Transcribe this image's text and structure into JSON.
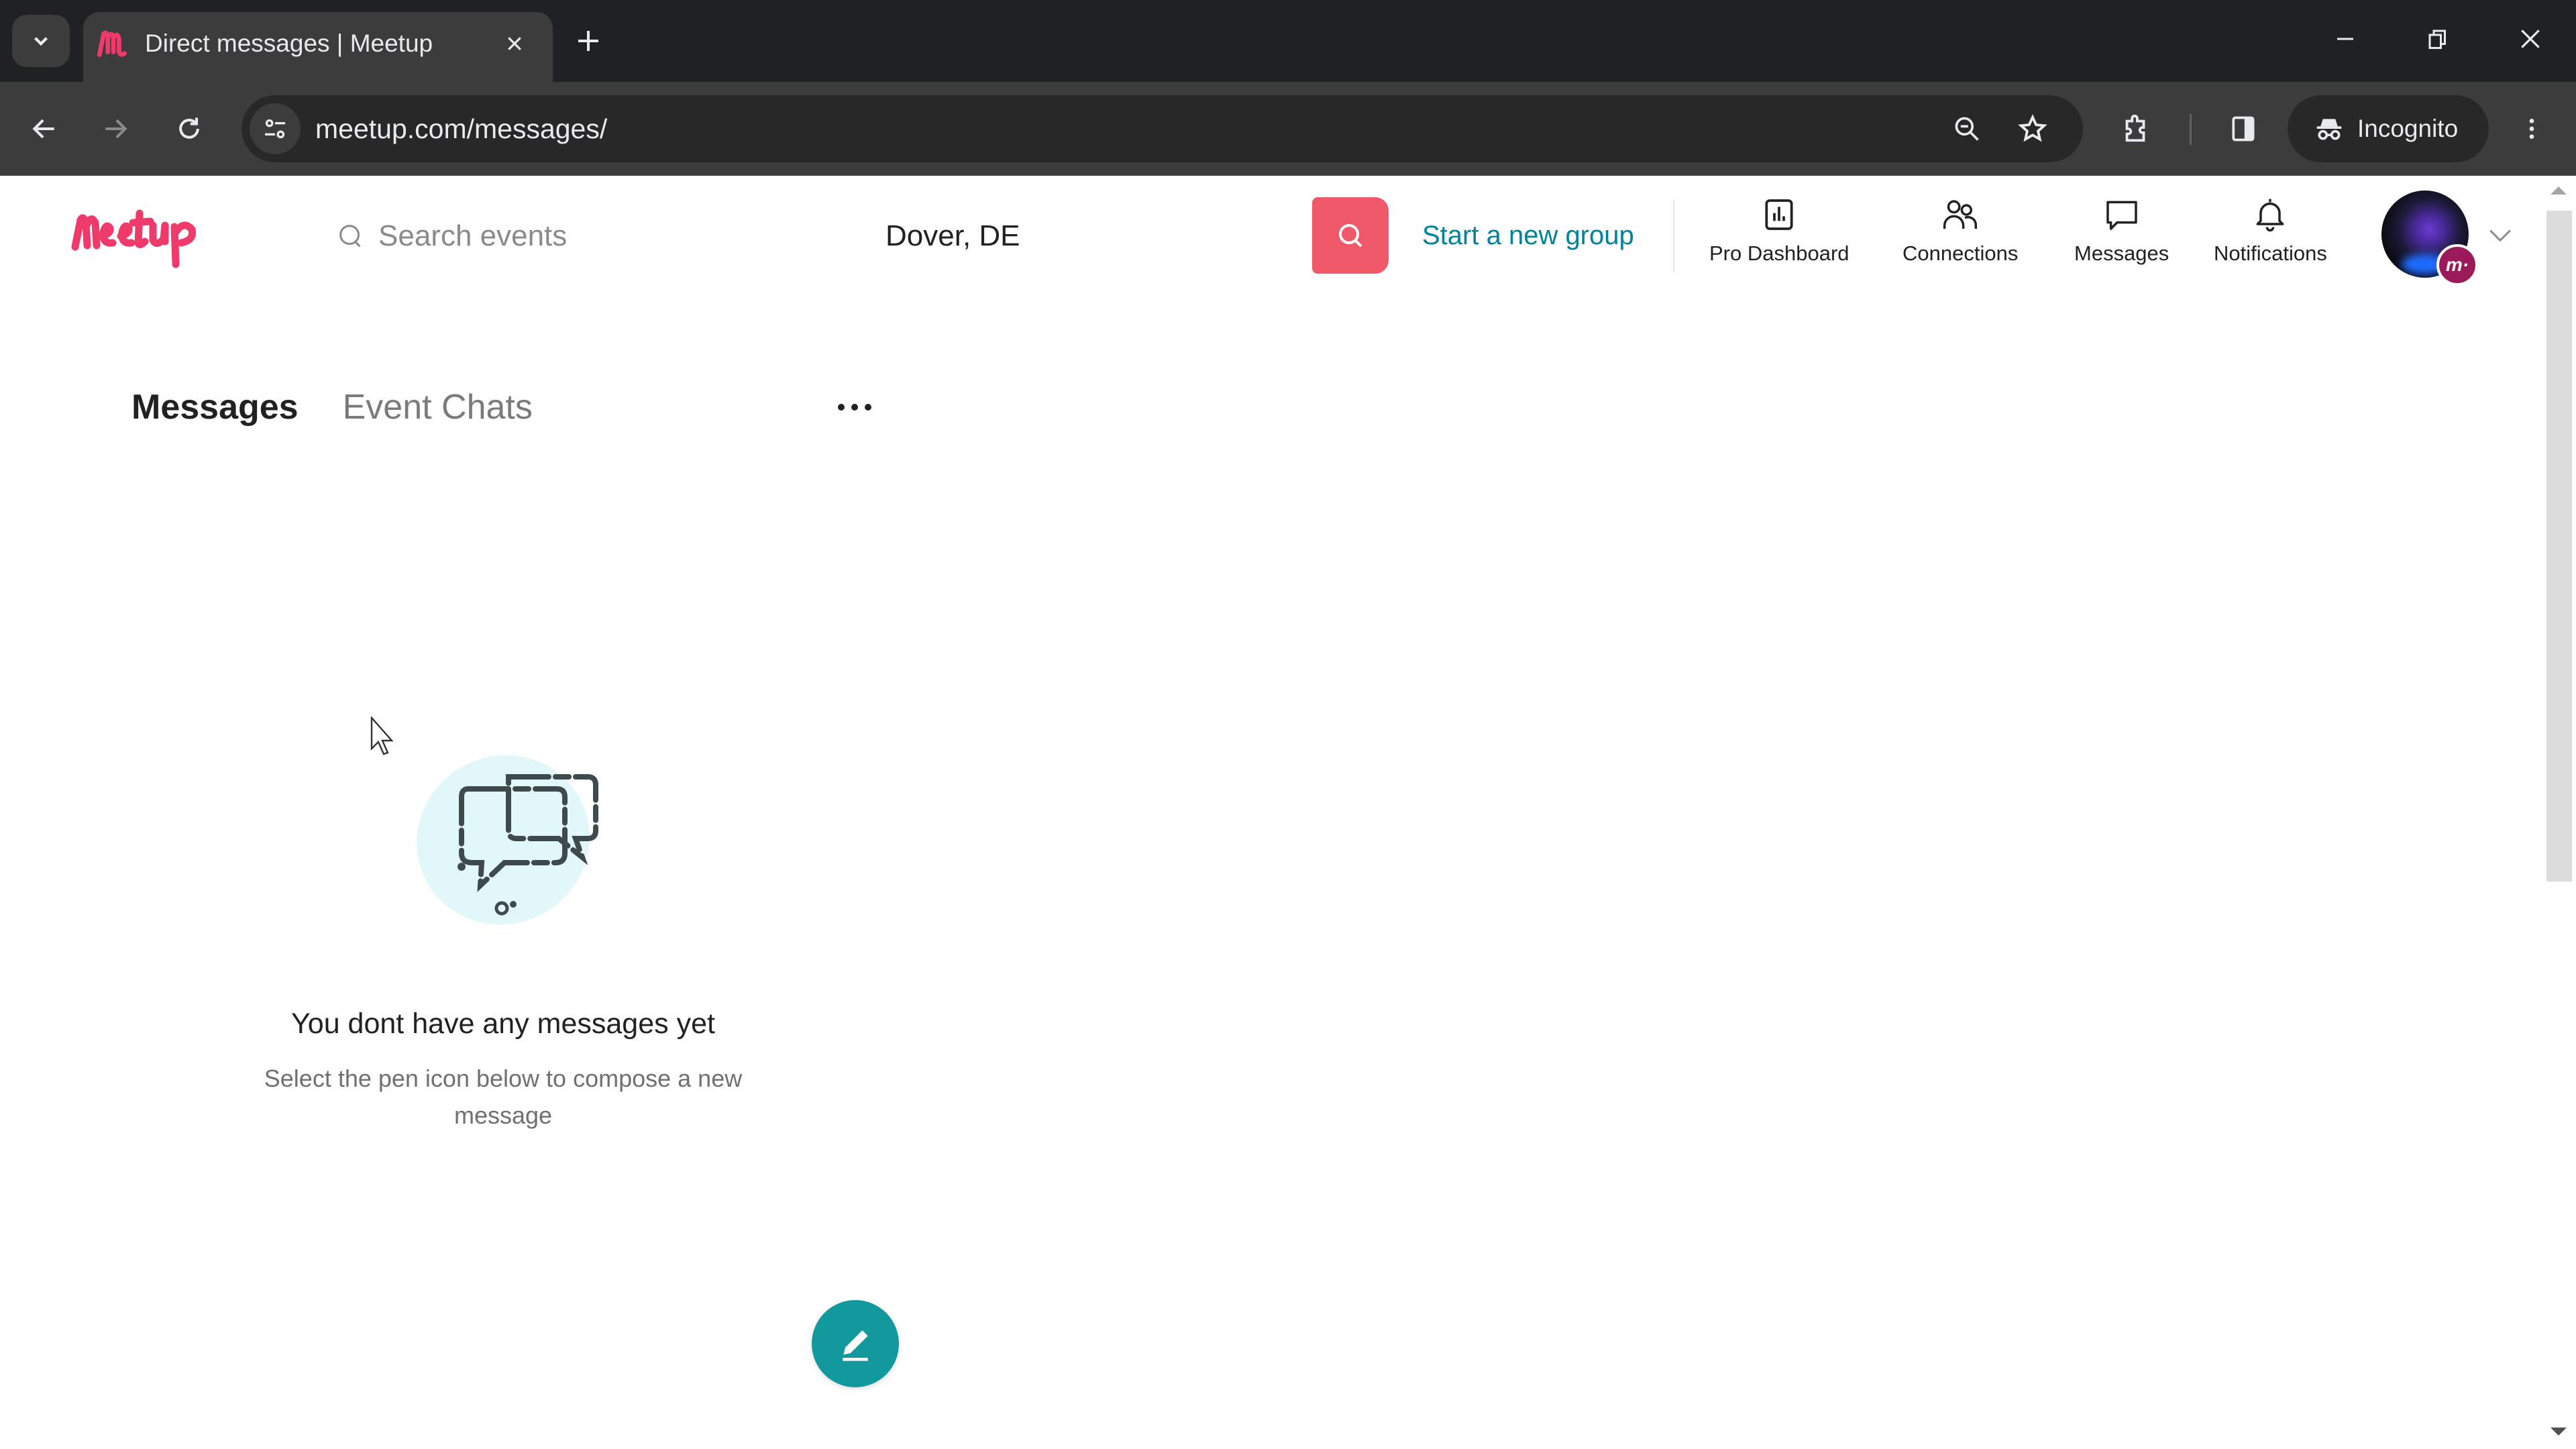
{
  "browser": {
    "tab_title": "Direct messages | Meetup",
    "url": "meetup.com/messages/",
    "incognito_label": "Incognito",
    "icons": {
      "tab_dropdown": "chevron-down-icon",
      "favicon": "meetup-favicon",
      "tab_close": "close-icon",
      "new_tab": "plus-icon",
      "minimize": "minimize-icon",
      "restore": "restore-icon",
      "close_window": "close-icon",
      "back": "arrow-left-icon",
      "forward": "arrow-right-icon",
      "reload": "reload-icon",
      "site_info": "tune-icon",
      "zoom": "zoom-out-icon",
      "bookmark": "star-icon",
      "extensions": "puzzle-icon",
      "side_panel": "side-panel-icon",
      "incognito": "incognito-icon",
      "menu": "kebab-menu-icon"
    }
  },
  "header": {
    "logo_text": "Meetup",
    "search_placeholder": "Search events",
    "location": "Dover, DE",
    "start_group_label": "Start a new group",
    "nav": [
      {
        "label": "Pro Dashboard",
        "icon": "bar-chart-icon"
      },
      {
        "label": "Connections",
        "icon": "people-icon"
      },
      {
        "label": "Messages",
        "icon": "chat-bubble-icon"
      },
      {
        "label": "Notifications",
        "icon": "bell-icon"
      }
    ],
    "avatar_badge": "m·"
  },
  "messages": {
    "tabs": [
      {
        "label": "Messages",
        "active": true
      },
      {
        "label": "Event Chats",
        "active": false
      }
    ],
    "more_label": "•••",
    "empty_title": "You dont have any messages yet",
    "empty_subtitle": "Select the pen icon below to compose a new message"
  },
  "colors": {
    "brand_pink": "#f13a6c",
    "search_button": "#f0596a",
    "link_teal": "#00829b",
    "compose_teal": "#11999e",
    "badge_magenta": "#9b1a5a"
  }
}
